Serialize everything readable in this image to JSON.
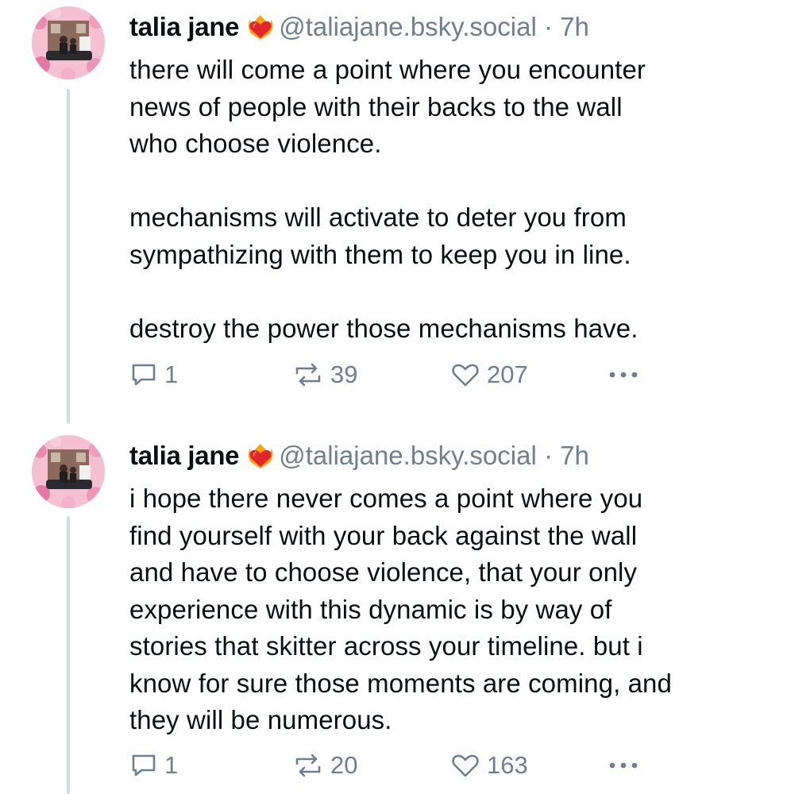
{
  "posts": [
    {
      "author_name": "talia jane",
      "badge_icon": "heart-on-fire-icon",
      "handle": "@taliajane.bsky.social",
      "separator": "·",
      "time": "7h",
      "text": "there will come a point where you encounter\nnews of people with their backs to the wall\nwho choose violence.\n\nmechanisms will activate to deter you from\nsympathizing with them to keep you in line.\n\ndestroy the power those mechanisms have.",
      "replies": "1",
      "reposts": "39",
      "likes": "207"
    },
    {
      "author_name": "talia jane",
      "badge_icon": "heart-on-fire-icon",
      "handle": "@taliajane.bsky.social",
      "separator": "·",
      "time": "7h",
      "text": "i hope there never comes a point where you\nfind yourself with your back against the wall\nand have to choose violence, that your only\nexperience with this dynamic is by way of\nstories that skitter across your timeline. but i\nknow for sure those moments are coming, and\nthey will be numerous.",
      "replies": "1",
      "reposts": "20",
      "likes": "163"
    }
  ],
  "colors": {
    "text": "#0b0f14",
    "muted": "#6f7f90",
    "thread_line": "#d4dbe2",
    "badge_red": "#e3262a",
    "badge_orange": "#f7a21b"
  }
}
